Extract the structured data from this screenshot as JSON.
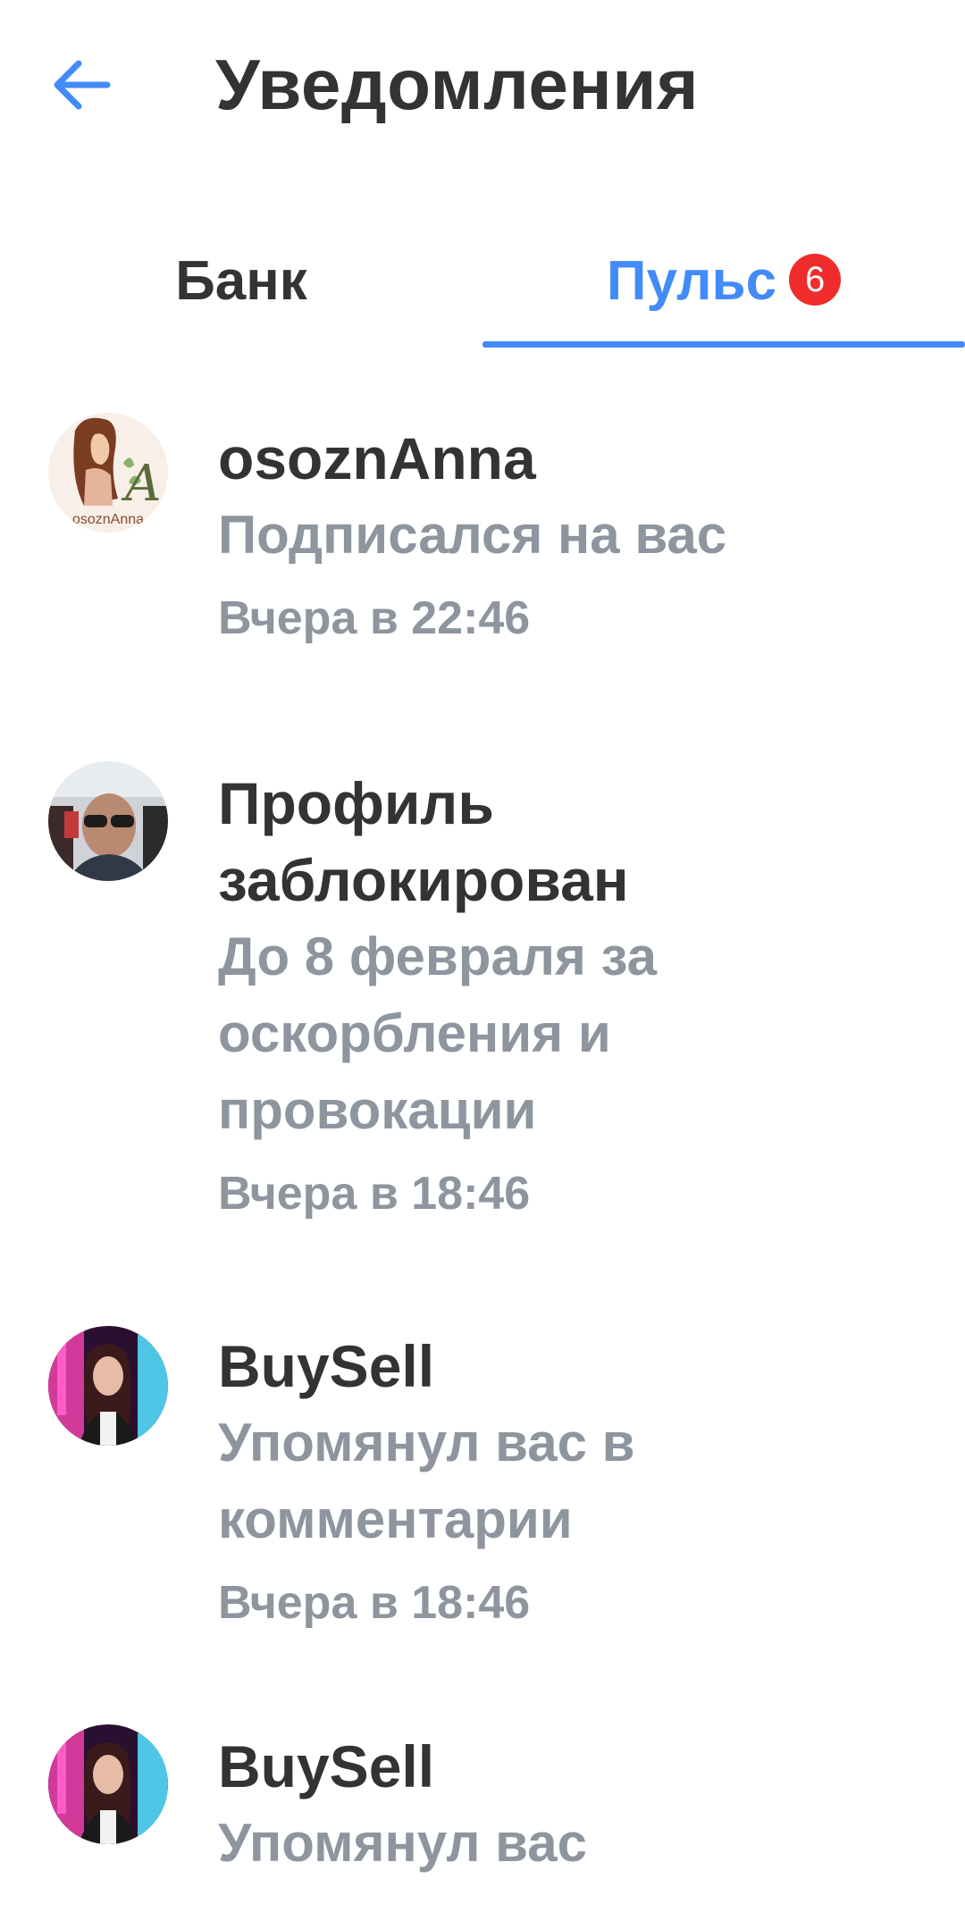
{
  "header": {
    "back_icon": "arrow-left-icon",
    "title": "Уведомления"
  },
  "tabs": [
    {
      "label": "Банк",
      "active": false
    },
    {
      "label": "Пульс",
      "active": true,
      "badge": "6"
    }
  ],
  "colors": {
    "accent": "#428bf9",
    "badge": "#ef2b2b",
    "primary_text": "#333333",
    "secondary_text": "#8e959f"
  },
  "notifications": [
    {
      "title": "osoznAnna",
      "description": "Подписался на вас",
      "time": "Вчера в 22:46",
      "avatar": {
        "type": "logo",
        "letter": "A",
        "caption": "osoznAnna"
      }
    },
    {
      "title": "Профиль заблокирован",
      "description": "До 8 февраля за оскорбления и провокации",
      "time": "Вчера в 18:46",
      "avatar": {
        "type": "photo"
      }
    },
    {
      "title": "BuySell",
      "description": "Упомянул вас в комментарии",
      "time": "Вчера в 18:46",
      "avatar": {
        "type": "photo"
      }
    },
    {
      "title": "BuySell",
      "description": "Упомянул вас",
      "time": "",
      "avatar": {
        "type": "photo"
      }
    }
  ]
}
